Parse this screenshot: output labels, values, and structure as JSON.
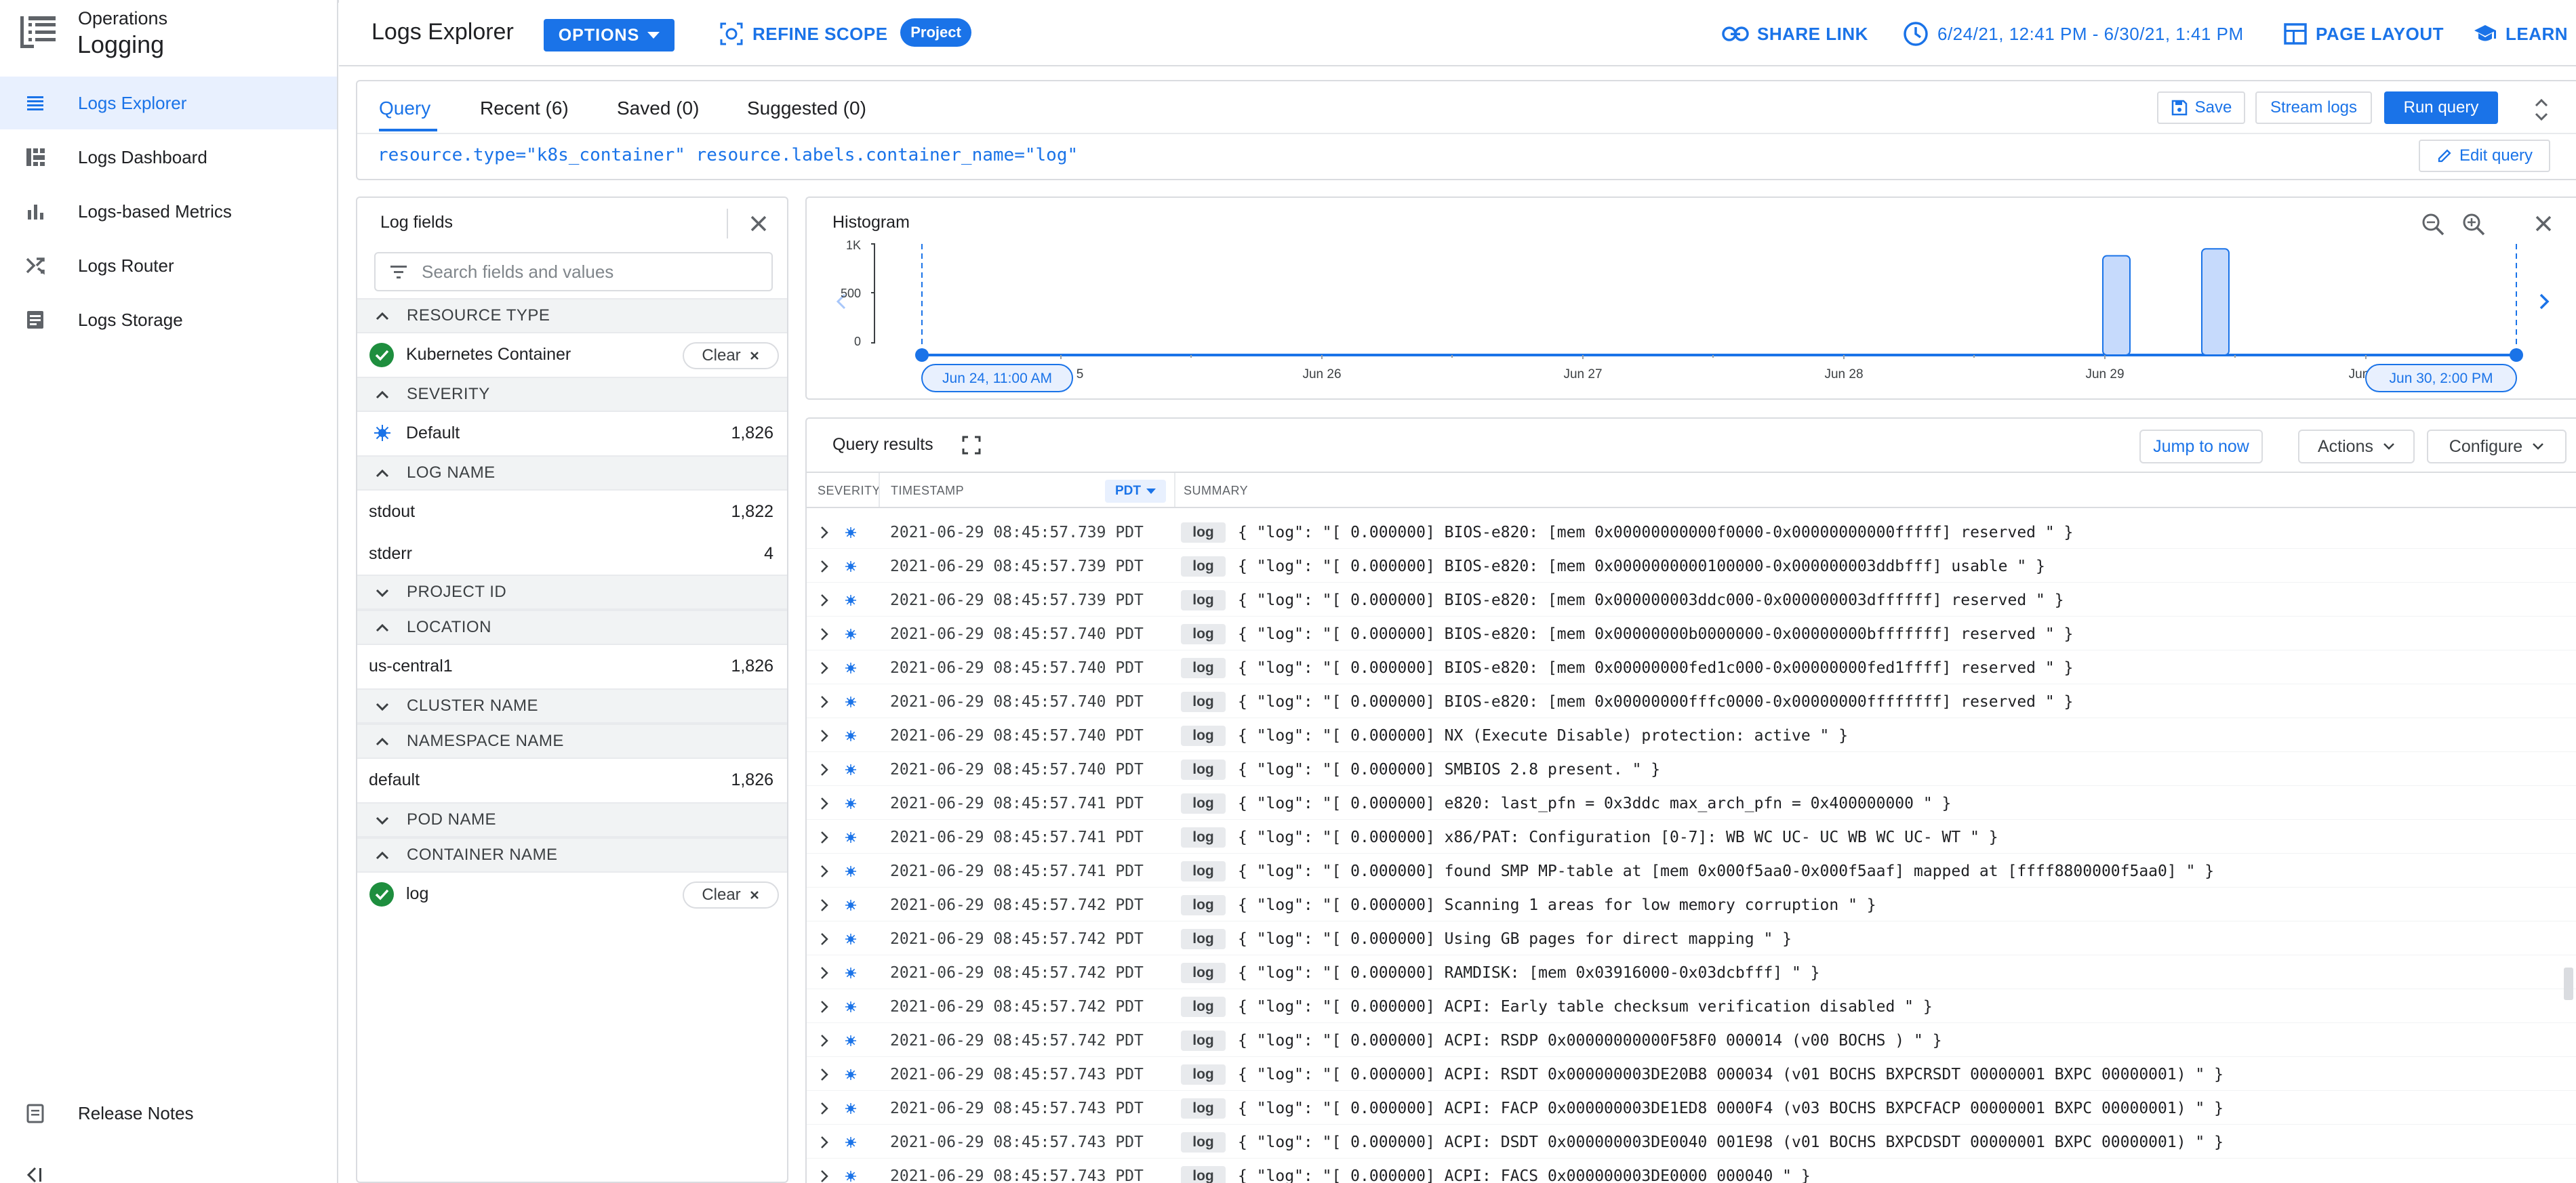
{
  "app": {
    "product": "Operations",
    "name": "Logging",
    "page_title": "Logs Explorer",
    "colors": {
      "accent": "#1a73e8",
      "success": "#1e8e3e",
      "text": "#202124",
      "border": "#dadce0"
    }
  },
  "nav": {
    "items": [
      {
        "label": "Logs Explorer",
        "icon": "list-icon",
        "active": true
      },
      {
        "label": "Logs Dashboard",
        "icon": "dashboard-icon",
        "active": false
      },
      {
        "label": "Logs-based Metrics",
        "icon": "bar-chart-icon",
        "active": false
      },
      {
        "label": "Logs Router",
        "icon": "router-icon",
        "active": false
      },
      {
        "label": "Logs Storage",
        "icon": "storage-icon",
        "active": false
      }
    ],
    "release_notes": "Release Notes"
  },
  "header": {
    "options": "OPTIONS",
    "refine_scope": "REFINE SCOPE",
    "scope_chip": "Project",
    "share_link": "SHARE LINK",
    "time_range": "6/24/21, 12:41 PM - 6/30/21, 1:41 PM",
    "page_layout": "PAGE LAYOUT",
    "learn": "LEARN"
  },
  "query": {
    "tabs": [
      "Query",
      "Recent (6)",
      "Saved (0)",
      "Suggested (0)"
    ],
    "active_tab": 0,
    "text": "resource.type=\"k8s_container\" resource.labels.container_name=\"log\"",
    "save": "Save",
    "stream_logs": "Stream logs",
    "run_query": "Run query",
    "edit_query": "Edit query"
  },
  "log_fields": {
    "title": "Log fields",
    "search_placeholder": "Search fields and values",
    "clear": "Clear",
    "sections": [
      {
        "name": "RESOURCE TYPE",
        "expanded": true
      },
      {
        "name": "SEVERITY",
        "expanded": true
      },
      {
        "name": "LOG NAME",
        "expanded": true
      },
      {
        "name": "PROJECT ID",
        "expanded": false
      },
      {
        "name": "LOCATION",
        "expanded": true
      },
      {
        "name": "CLUSTER NAME",
        "expanded": false
      },
      {
        "name": "NAMESPACE NAME",
        "expanded": true
      },
      {
        "name": "POD NAME",
        "expanded": false
      },
      {
        "name": "CONTAINER NAME",
        "expanded": true
      }
    ],
    "values": {
      "resource_type": "Kubernetes Container",
      "severity": {
        "name": "Default",
        "count": "1,826"
      },
      "log_name": [
        {
          "name": "stdout",
          "count": "1,822"
        },
        {
          "name": "stderr",
          "count": "4"
        }
      ],
      "location": {
        "name": "us-central1",
        "count": "1,826"
      },
      "namespace": {
        "name": "default",
        "count": "1,826"
      },
      "container": "log"
    }
  },
  "histogram": {
    "title": "Histogram",
    "y_ticks": [
      "1K",
      "500",
      "0"
    ],
    "x_ticks": [
      "5",
      "Jun 26",
      "Jun 27",
      "Jun 28",
      "Jun 29",
      "Jun"
    ],
    "start_label": "Jun 24, 11:00 AM",
    "end_label": "Jun 30, 2:00 PM"
  },
  "chart_data": {
    "type": "bar",
    "title": "Histogram",
    "ylim": [
      0,
      1000
    ],
    "grid": false,
    "categories": [
      "Jun 29 ~08:00",
      "Jun 29 ~20:00"
    ],
    "values": [
      880,
      950
    ]
  },
  "results": {
    "title": "Query results",
    "jump_to_now": "Jump to now",
    "actions": "Actions",
    "configure": "Configure",
    "columns": {
      "severity": "SEVERITY",
      "timestamp": "TIMESTAMP",
      "tz": "PDT",
      "summary": "SUMMARY"
    },
    "rows": [
      {
        "ts": "2021-06-29 08:45:57.739 PDT",
        "tag": "log",
        "summary": "{ \"log\": \"[ 0.000000] BIOS-e820: [mem 0x00000000000f0000-0x00000000000fffff] reserved \" }"
      },
      {
        "ts": "2021-06-29 08:45:57.739 PDT",
        "tag": "log",
        "summary": "{ \"log\": \"[ 0.000000] BIOS-e820: [mem 0x0000000000100000-0x000000003ddbfff] usable \" }"
      },
      {
        "ts": "2021-06-29 08:45:57.739 PDT",
        "tag": "log",
        "summary": "{ \"log\": \"[ 0.000000] BIOS-e820: [mem 0x000000003ddc000-0x000000003dffffff] reserved \" }"
      },
      {
        "ts": "2021-06-29 08:45:57.740 PDT",
        "tag": "log",
        "summary": "{ \"log\": \"[ 0.000000] BIOS-e820: [mem 0x00000000b0000000-0x00000000bfffffff] reserved \" }"
      },
      {
        "ts": "2021-06-29 08:45:57.740 PDT",
        "tag": "log",
        "summary": "{ \"log\": \"[ 0.000000] BIOS-e820: [mem 0x00000000fed1c000-0x00000000fed1ffff] reserved \" }"
      },
      {
        "ts": "2021-06-29 08:45:57.740 PDT",
        "tag": "log",
        "summary": "{ \"log\": \"[ 0.000000] BIOS-e820: [mem 0x00000000fffc0000-0x00000000ffffffff] reserved \" }"
      },
      {
        "ts": "2021-06-29 08:45:57.740 PDT",
        "tag": "log",
        "summary": "{ \"log\": \"[ 0.000000] NX (Execute Disable) protection: active \" }"
      },
      {
        "ts": "2021-06-29 08:45:57.740 PDT",
        "tag": "log",
        "summary": "{ \"log\": \"[ 0.000000] SMBIOS 2.8 present. \" }"
      },
      {
        "ts": "2021-06-29 08:45:57.741 PDT",
        "tag": "log",
        "summary": "{ \"log\": \"[ 0.000000] e820: last_pfn = 0x3ddc max_arch_pfn = 0x400000000 \" }"
      },
      {
        "ts": "2021-06-29 08:45:57.741 PDT",
        "tag": "log",
        "summary": "{ \"log\": \"[ 0.000000] x86/PAT: Configuration [0-7]: WB WC UC- UC WB WC UC- WT \" }"
      },
      {
        "ts": "2021-06-29 08:45:57.741 PDT",
        "tag": "log",
        "summary": "{ \"log\": \"[ 0.000000] found SMP MP-table at [mem 0x000f5aa0-0x000f5aaf] mapped at [ffff8800000f5aa0] \" }"
      },
      {
        "ts": "2021-06-29 08:45:57.742 PDT",
        "tag": "log",
        "summary": "{ \"log\": \"[ 0.000000] Scanning 1 areas for low memory corruption \" }"
      },
      {
        "ts": "2021-06-29 08:45:57.742 PDT",
        "tag": "log",
        "summary": "{ \"log\": \"[ 0.000000] Using GB pages for direct mapping \" }"
      },
      {
        "ts": "2021-06-29 08:45:57.742 PDT",
        "tag": "log",
        "summary": "{ \"log\": \"[ 0.000000] RAMDISK: [mem 0x03916000-0x03dcbfff] \" }"
      },
      {
        "ts": "2021-06-29 08:45:57.742 PDT",
        "tag": "log",
        "summary": "{ \"log\": \"[ 0.000000] ACPI: Early table checksum verification disabled \" }"
      },
      {
        "ts": "2021-06-29 08:45:57.742 PDT",
        "tag": "log",
        "summary": "{ \"log\": \"[ 0.000000] ACPI: RSDP 0x00000000000F58F0 000014 (v00 BOCHS ) \" }"
      },
      {
        "ts": "2021-06-29 08:45:57.743 PDT",
        "tag": "log",
        "summary": "{ \"log\": \"[ 0.000000] ACPI: RSDT 0x000000003DE20B8 000034 (v01 BOCHS BXPCRSDT 00000001 BXPC 00000001) \" }"
      },
      {
        "ts": "2021-06-29 08:45:57.743 PDT",
        "tag": "log",
        "summary": "{ \"log\": \"[ 0.000000] ACPI: FACP 0x000000003DE1ED8 0000F4 (v03 BOCHS BXPCFACP 00000001 BXPC 00000001) \" }"
      },
      {
        "ts": "2021-06-29 08:45:57.743 PDT",
        "tag": "log",
        "summary": "{ \"log\": \"[ 0.000000] ACPI: DSDT 0x000000003DE0040 001E98 (v01 BOCHS BXPCDSDT 00000001 BXPC 00000001) \" }"
      },
      {
        "ts": "2021-06-29 08:45:57.743 PDT",
        "tag": "log",
        "summary": "{ \"log\": \"[ 0.000000] ACPI: FACS 0x000000003DE0000 000040 \" }"
      }
    ]
  }
}
